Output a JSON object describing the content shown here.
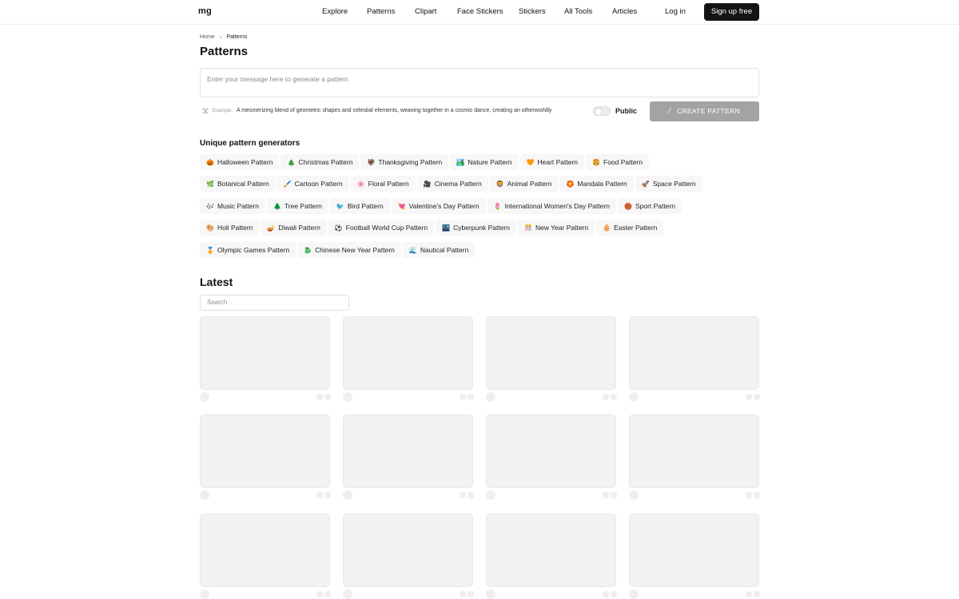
{
  "header": {
    "logo": "mg",
    "nav": [
      "Explore",
      "Patterns",
      "Clipart",
      "Face Stickers",
      "Stickers",
      "All Tools",
      "Articles"
    ],
    "login": "Log in",
    "signup": "Sign up free"
  },
  "breadcrumb": {
    "home": "Home",
    "current": "Patterns"
  },
  "page_title": "Patterns",
  "prompt": {
    "placeholder": "Enter your message here to generate a pattern"
  },
  "example": {
    "label": "Example:",
    "text": "A mesmerizing blend of geometric shapes and celestial elements, weaving together in a cosmic dance, creating an otherworldly"
  },
  "public_label": "Public",
  "public_toggle_on": false,
  "create_button": "CREATE PATTERN",
  "generators": {
    "title": "Unique pattern generators",
    "rows": [
      [
        {
          "emoji": "🎃",
          "label": "Halloween Pattern"
        },
        {
          "emoji": "🎄",
          "label": "Christmas Pattern"
        },
        {
          "emoji": "🦃",
          "label": "Thanksgiving Pattern"
        },
        {
          "emoji": "🏞️",
          "label": "Nature Pattern"
        },
        {
          "emoji": "🧡",
          "label": "Heart Pattern"
        },
        {
          "emoji": "🍔",
          "label": "Food Pattern"
        }
      ],
      [
        {
          "emoji": "🌿",
          "label": "Botanical Pattern"
        },
        {
          "emoji": "🖌️",
          "label": "Cartoon Pattern"
        },
        {
          "emoji": "🌸",
          "label": "Floral Pattern"
        },
        {
          "emoji": "🎥",
          "label": "Cinema Pattern"
        },
        {
          "emoji": "🦁",
          "label": "Animal Pattern"
        },
        {
          "emoji": "🏵️",
          "label": "Mandala Pattern"
        },
        {
          "emoji": "🚀",
          "label": "Space Pattern"
        }
      ],
      [
        {
          "emoji": "🎶",
          "label": "Music Pattern"
        },
        {
          "emoji": "🌲",
          "label": "Tree Pattern"
        },
        {
          "emoji": "🐦",
          "label": "Bird Pattern"
        },
        {
          "emoji": "💘",
          "label": "Valentine's Day Pattern"
        },
        {
          "emoji": "🌷",
          "label": "International Women's Day Pattern"
        },
        {
          "emoji": "🏀",
          "label": "Sport Pattern"
        }
      ],
      [
        {
          "emoji": "🎨",
          "label": "Holi Pattern"
        },
        {
          "emoji": "🪔",
          "label": "Diwali Pattern"
        },
        {
          "emoji": "⚽",
          "label": "Football World Cup Pattern"
        },
        {
          "emoji": "🌃",
          "label": "Cyberpunk Pattern"
        },
        {
          "emoji": "🎊",
          "label": "New Year Pattern"
        },
        {
          "emoji": "🥚",
          "label": "Easter Pattern"
        }
      ],
      [
        {
          "emoji": "🏅",
          "label": "Olympic Games Pattern"
        },
        {
          "emoji": "🐉",
          "label": "Chinese New Year Pattern"
        },
        {
          "emoji": "🌊",
          "label": "Nautical Pattern"
        }
      ]
    ]
  },
  "latest": {
    "title": "Latest",
    "search_placeholder": "Search"
  },
  "colors": {
    "accent": "#141414",
    "button_disabled": "#a3a3a3",
    "chip_bg": "#f7f7f7",
    "skeleton": "#f2f2f2"
  }
}
